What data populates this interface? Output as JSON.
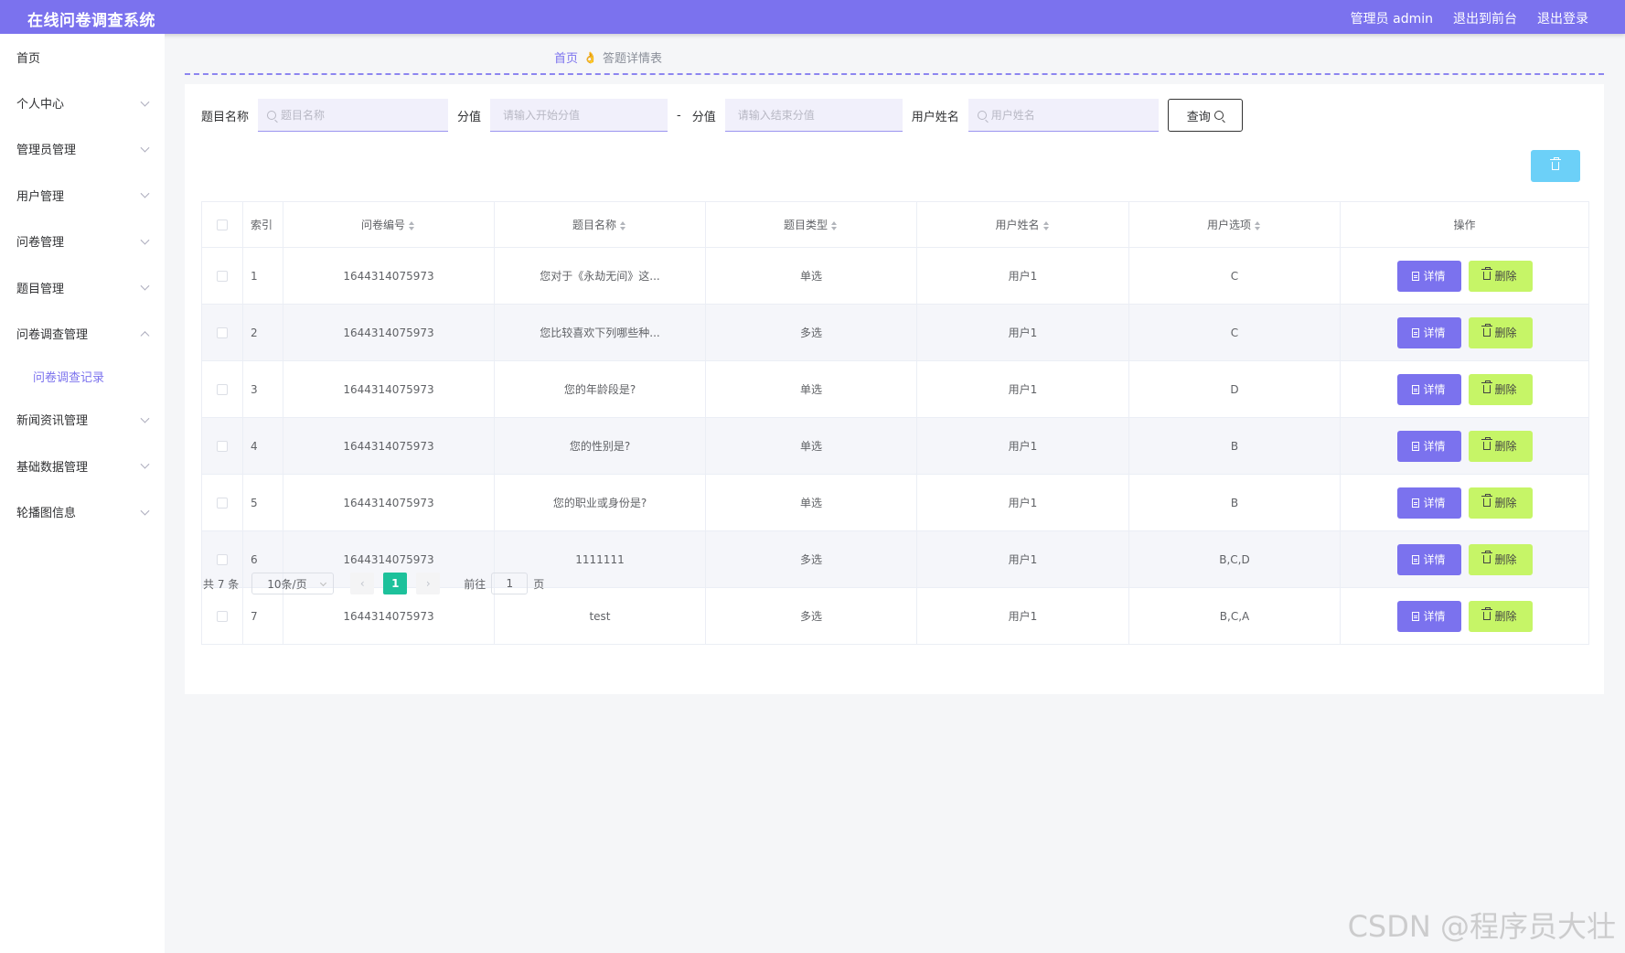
{
  "app": {
    "title": "在线问卷调查系统"
  },
  "header": {
    "user": "管理员 admin",
    "to_front": "退出到前台",
    "logout": "退出登录"
  },
  "sidebar": {
    "items": [
      {
        "label": "首页",
        "arrow": "none"
      },
      {
        "label": "个人中心",
        "arrow": "down"
      },
      {
        "label": "管理员管理",
        "arrow": "down"
      },
      {
        "label": "用户管理",
        "arrow": "down"
      },
      {
        "label": "问卷管理",
        "arrow": "down"
      },
      {
        "label": "题目管理",
        "arrow": "down"
      },
      {
        "label": "问卷调查管理",
        "arrow": "up"
      }
    ],
    "submenu": {
      "label": "问卷调查记录"
    },
    "items_after": [
      {
        "label": "新闻资讯管理"
      },
      {
        "label": "基础数据管理"
      },
      {
        "label": "轮播图信息"
      }
    ]
  },
  "breadcrumb": {
    "home": "首页",
    "separator": "👌",
    "current": "答题详情表"
  },
  "search": {
    "title_label": "题目名称",
    "title_placeholder": "题目名称",
    "score_label": "分值",
    "score_start_placeholder": "请输入开始分值",
    "dash": "-",
    "score_label2": "分值",
    "score_end_placeholder": "请输入结束分值",
    "user_label": "用户姓名",
    "user_placeholder": "用户姓名",
    "query_label": "查询"
  },
  "table": {
    "headers": [
      "索引",
      "问卷编号",
      "题目名称",
      "题目类型",
      "用户姓名",
      "用户选项",
      "操作"
    ],
    "detail_label": "详情",
    "delete_label": "删除",
    "rows": [
      {
        "index": "1",
        "survey_no": "1644314075973",
        "question": "您对于《永劫无间》这...",
        "type": "单选",
        "user": "用户1",
        "option": "C"
      },
      {
        "index": "2",
        "survey_no": "1644314075973",
        "question": "您比较喜欢下列哪些种...",
        "type": "多选",
        "user": "用户1",
        "option": "C"
      },
      {
        "index": "3",
        "survey_no": "1644314075973",
        "question": "您的年龄段是?",
        "type": "单选",
        "user": "用户1",
        "option": "D"
      },
      {
        "index": "4",
        "survey_no": "1644314075973",
        "question": "您的性别是?",
        "type": "单选",
        "user": "用户1",
        "option": "B"
      },
      {
        "index": "5",
        "survey_no": "1644314075973",
        "question": "您的职业或身份是?",
        "type": "单选",
        "user": "用户1",
        "option": "B"
      },
      {
        "index": "6",
        "survey_no": "1644314075973",
        "question": "1111111",
        "type": "多选",
        "user": "用户1",
        "option": "B,C,D"
      },
      {
        "index": "7",
        "survey_no": "1644314075973",
        "question": "test",
        "type": "多选",
        "user": "用户1",
        "option": "B,C,A"
      }
    ]
  },
  "pagination": {
    "total": "共 7 条",
    "page_size": "10条/页",
    "prev": "‹",
    "current_page": "1",
    "next": "›",
    "goto_label": "前往",
    "goto_value": "1",
    "page_unit": "页"
  },
  "watermark": "CSDN @程序员大壮",
  "colors": {
    "primary": "#7b72ee",
    "delete": "#c6f567",
    "batch_delete": "#6cd0f8",
    "active_page": "#1dc19b"
  }
}
